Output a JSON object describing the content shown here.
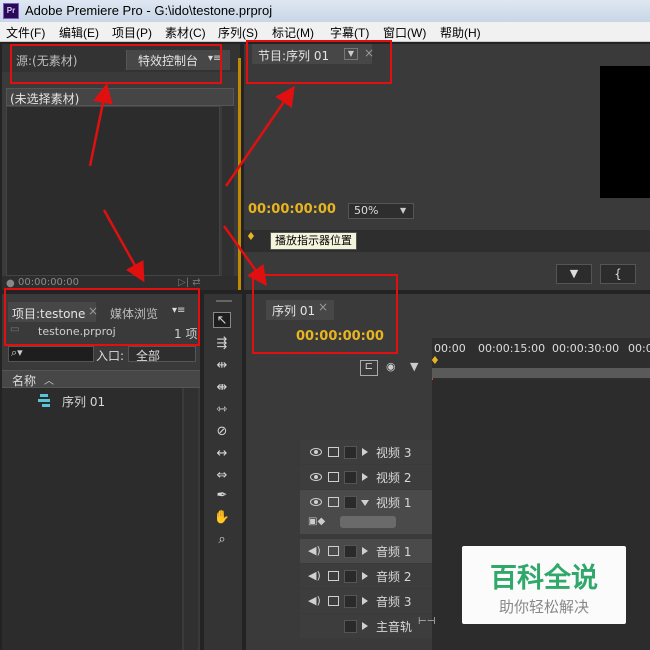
{
  "window": {
    "title": "Adobe Premiere Pro - G:\\ido\\testone.prproj",
    "app_icon": "Pr"
  },
  "menu": [
    {
      "label": "文件(F)"
    },
    {
      "label": "编辑(E)"
    },
    {
      "label": "项目(P)"
    },
    {
      "label": "素材(C)"
    },
    {
      "label": "序列(S)"
    },
    {
      "label": "标记(M)"
    },
    {
      "label": "字幕(T)"
    },
    {
      "label": "窗口(W)"
    },
    {
      "label": "帮助(H)"
    }
  ],
  "source_panel": {
    "tab_source": "源:(无素材)",
    "tab_effects": "特效控制台",
    "no_selection": "(未选择素材)",
    "timecode": "00:00:00:00"
  },
  "program_panel": {
    "tab": "节目:序列 01",
    "timecode": "00:00:00:00",
    "zoom": "50%",
    "tooltip": "播放指示器位置"
  },
  "project_panel": {
    "tab_project": "项目:testone",
    "tab_media": "媒体浏览",
    "file_name": "testone.prproj",
    "item_count": "1 项",
    "entry_label": "入口:",
    "entry_value": "全部",
    "column_name": "名称",
    "items": [
      {
        "label": "序列 01"
      }
    ]
  },
  "timeline": {
    "tab": "序列 01",
    "timecode": "00:00:00:00",
    "ruler": [
      "00:00",
      "00:00:15:00",
      "00:00:30:00",
      "00:0"
    ],
    "video_tracks": [
      {
        "label": "视频 3"
      },
      {
        "label": "视频 2"
      },
      {
        "label": "视频 1"
      }
    ],
    "audio_tracks": [
      {
        "label": "音频 1"
      },
      {
        "label": "音频 2"
      },
      {
        "label": "音频 3"
      }
    ],
    "master": "主音轨"
  },
  "watermark": {
    "title": "百科全说",
    "subtitle": "助你轻松解决"
  }
}
